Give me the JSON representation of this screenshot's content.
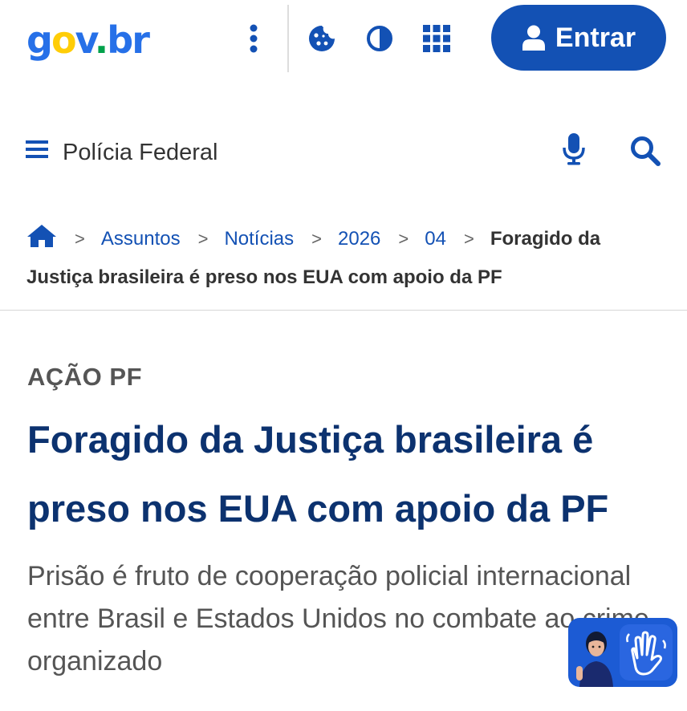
{
  "header": {
    "logo": {
      "part1": "g",
      "part2": "o",
      "part3": "v",
      "part4": ".",
      "part5": "br"
    },
    "login_label": "Entrar",
    "icons": {
      "menu": "kebab-icon",
      "cookie": "cookie-icon",
      "contrast": "contrast-icon",
      "apps": "apps-grid-icon",
      "user": "user-icon"
    }
  },
  "site": {
    "title": "Polícia Federal",
    "icons": {
      "menu": "hamburger-icon",
      "mic": "microphone-icon",
      "search": "search-icon"
    }
  },
  "breadcrumb": {
    "home_icon": "home-icon",
    "separator": ">",
    "items": [
      "Assuntos",
      "Notícias",
      "2026",
      "04"
    ],
    "current": "Foragido da Justiça brasileira é preso nos EUA com apoio da PF"
  },
  "article": {
    "kicker": "AÇÃO PF",
    "title": "Foragido da Justiça brasileira é preso nos EUA com apoio da PF",
    "subtitle": "Prisão é fruto de cooperação policial internacional entre Brasil e Estados Unidos no combate ao crime organizado"
  },
  "accessibility_widget": {
    "icon": "sign-language-icon"
  },
  "colors": {
    "primary": "#1351b4",
    "headline": "#0c326f",
    "logo_blue": "#2670e8",
    "logo_yellow": "#ffcd07",
    "logo_green": "#00a14b"
  }
}
